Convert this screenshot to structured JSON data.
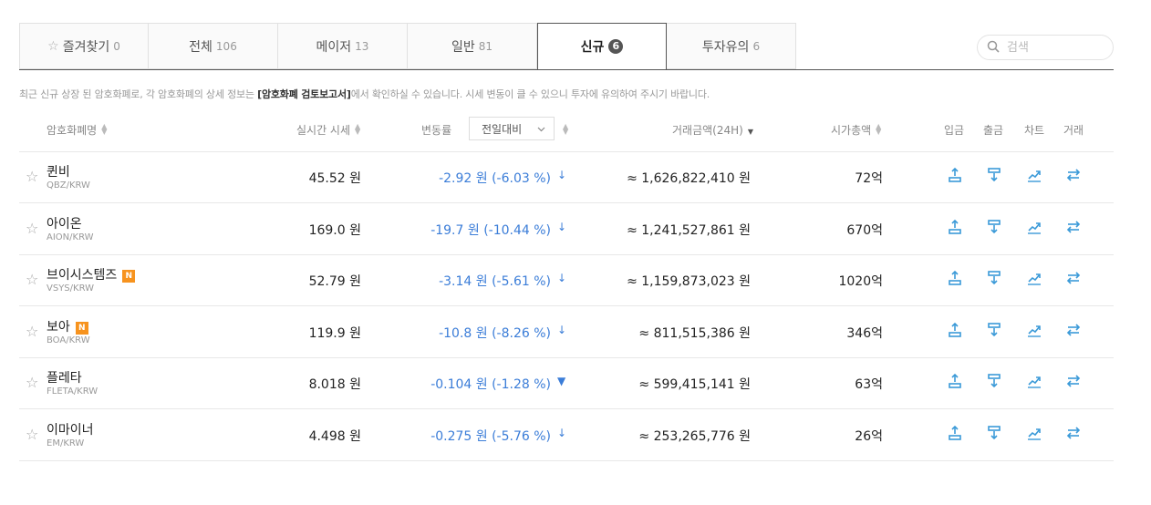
{
  "tabs": [
    {
      "label": "즐겨찾기",
      "count": "0",
      "icon": "star-outline-icon"
    },
    {
      "label": "전체",
      "count": "106"
    },
    {
      "label": "메이저",
      "count": "13"
    },
    {
      "label": "일반",
      "count": "81"
    },
    {
      "label": "신규",
      "count": "6",
      "active": true
    },
    {
      "label": "투자유의",
      "count": "6"
    }
  ],
  "search": {
    "placeholder": "검색"
  },
  "notice": {
    "pre": "최근 신규 상장 된 암호화폐로, 각 암호화폐의 상세 정보는 ",
    "bold": "[암호화폐 검토보고서]",
    "post": "에서 확인하실 수 있습니다. 시세 변동이 클 수 있으니 투자에 유의하여 주시기 바랍니다."
  },
  "headers": {
    "name": "암호화폐명",
    "price": "실시간 시세",
    "change": "변동률",
    "change_select": "전일대비",
    "volume": "거래금액(24H)",
    "cap": "시가총액",
    "deposit": "입금",
    "withdraw": "출금",
    "chart": "차트",
    "trade": "거래"
  },
  "accent_color": "#3b7dd8",
  "new_badge_color": "#f7931e",
  "rows": [
    {
      "name": "퀸비",
      "pair": "QBZ/KRW",
      "new": "",
      "price": "45.52 원",
      "change": "-2.92 원 (-6.03 %)",
      "arrow": "↓",
      "volume": "≈ 1,626,822,410 원",
      "cap": "72억"
    },
    {
      "name": "아이온",
      "pair": "AION/KRW",
      "new": "",
      "price": "169.0 원",
      "change": "-19.7 원 (-10.44 %)",
      "arrow": "↓",
      "volume": "≈ 1,241,527,861 원",
      "cap": "670억"
    },
    {
      "name": "브이시스템즈",
      "pair": "VSYS/KRW",
      "new": "N",
      "price": "52.79 원",
      "change": "-3.14 원 (-5.61 %)",
      "arrow": "↓",
      "volume": "≈ 1,159,873,023 원",
      "cap": "1020억"
    },
    {
      "name": "보아",
      "pair": "BOA/KRW",
      "new": "N",
      "price": "119.9 원",
      "change": "-10.8 원 (-8.26 %)",
      "arrow": "↓",
      "volume": "≈ 811,515,386 원",
      "cap": "346억"
    },
    {
      "name": "플레타",
      "pair": "FLETA/KRW",
      "new": "",
      "price": "8.018 원",
      "change": "-0.104 원 (-1.28 %)",
      "arrow": "▼",
      "volume": "≈ 599,415,141 원",
      "cap": "63억"
    },
    {
      "name": "이마이너",
      "pair": "EM/KRW",
      "new": "",
      "price": "4.498 원",
      "change": "-0.275 원 (-5.76 %)",
      "arrow": "↓",
      "volume": "≈ 253,265,776 원",
      "cap": "26억"
    }
  ]
}
